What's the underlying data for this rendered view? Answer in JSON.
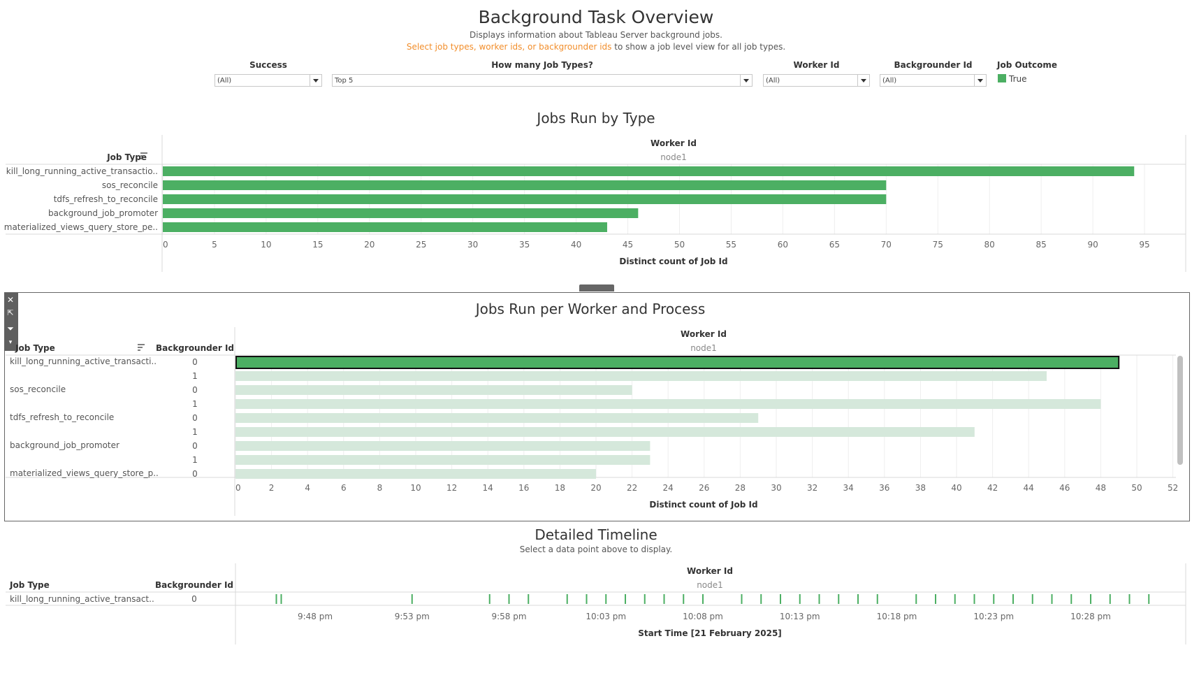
{
  "header": {
    "title": "Background Task Overview",
    "subtitle": "Displays information about Tableau Server background jobs.",
    "hint_highlight": "Select job types, worker ids, or backgrounder ids",
    "hint_rest": " to show a job level view for all job types."
  },
  "filters": {
    "success": {
      "label": "Success",
      "value": "(All)"
    },
    "job_types": {
      "label": "How many Job Types?",
      "value": "Top 5"
    },
    "worker_id": {
      "label": "Worker Id",
      "value": "(All)"
    },
    "backgrounder_id": {
      "label": "Backgrounder Id",
      "value": "(All)"
    },
    "legend": {
      "label": "Job Outcome",
      "item": "True",
      "color": "#4caf63"
    }
  },
  "colors": {
    "bar": "#4caf63",
    "bar_dim": "#d5e8db",
    "grid": "#eeeeee",
    "axis": "#d8d8d8"
  },
  "chart_data": [
    {
      "type": "bar",
      "title": "Jobs Run by Type",
      "row_header": "Job Type",
      "column_header": "Worker Id",
      "column_value": "node1",
      "xlabel": "Distinct count of Job Id",
      "categories": [
        "kill_long_running_active_transactio..",
        "sos_reconcile",
        "tdfs_refresh_to_reconcile",
        "background_job_promoter",
        "materialized_views_query_store_pe.."
      ],
      "values": [
        94,
        70,
        70,
        46,
        43
      ],
      "xlim": [
        0,
        97
      ],
      "ticks": [
        0,
        5,
        10,
        15,
        20,
        25,
        30,
        35,
        40,
        45,
        50,
        55,
        60,
        65,
        70,
        75,
        80,
        85,
        90,
        95
      ]
    },
    {
      "type": "bar",
      "title": "Jobs Run per Worker and Process",
      "row_header": "Job Type",
      "row_header2": "Backgrounder Id",
      "column_header": "Worker Id",
      "column_value": "node1",
      "xlabel": "Distinct count of Job Id",
      "rows": [
        {
          "job": "kill_long_running_active_transacti..",
          "bg": "0",
          "value": 49,
          "selected": true
        },
        {
          "job": "",
          "bg": "1",
          "value": 45
        },
        {
          "job": "sos_reconcile",
          "bg": "0",
          "value": 22
        },
        {
          "job": "",
          "bg": "1",
          "value": 48
        },
        {
          "job": "tdfs_refresh_to_reconcile",
          "bg": "0",
          "value": 29
        },
        {
          "job": "",
          "bg": "1",
          "value": 41
        },
        {
          "job": "background_job_promoter",
          "bg": "0",
          "value": 23
        },
        {
          "job": "",
          "bg": "1",
          "value": 23
        },
        {
          "job": "materialized_views_query_store_p..",
          "bg": "0",
          "value": 20
        }
      ],
      "xlim": [
        0,
        52.4
      ],
      "ticks": [
        0,
        2,
        4,
        6,
        8,
        10,
        12,
        14,
        16,
        18,
        20,
        22,
        24,
        26,
        28,
        30,
        32,
        34,
        36,
        38,
        40,
        42,
        44,
        46,
        48,
        50,
        52
      ]
    },
    {
      "type": "scatter",
      "title": "Detailed Timeline",
      "subtitle": "Select a data point above to display.",
      "row_header": "Job Type",
      "row_header2": "Backgrounder Id",
      "column_header": "Worker Id",
      "column_value": "node1",
      "row_job": "kill_long_running_active_transact..",
      "row_bg": "0",
      "xlabel": "Start Time [21 February 2025]",
      "tick_labels": [
        "9:48 pm",
        "9:53 pm",
        "9:58 pm",
        "10:03 pm",
        "10:08 pm",
        "10:13 pm",
        "10:18 pm",
        "10:23 pm",
        "10:28 pm"
      ],
      "events": [
        "9:46 pm",
        "9:46 pm",
        "9:53 pm",
        "9:57 pm",
        "9:58 pm",
        "9:59 pm",
        "10:01 pm",
        "10:02 pm",
        "10:03 pm",
        "10:04 pm",
        "10:05 pm",
        "10:06 pm",
        "10:07 pm",
        "10:08 pm",
        "10:10 pm",
        "10:11 pm",
        "10:12 pm",
        "10:13 pm",
        "10:14 pm",
        "10:15 pm",
        "10:16 pm",
        "10:17 pm",
        "10:19 pm",
        "10:20 pm",
        "10:21 pm",
        "10:22 pm",
        "10:23 pm",
        "10:24 pm",
        "10:25 pm",
        "10:26 pm",
        "10:27 pm",
        "10:28 pm",
        "10:29 pm",
        "10:30 pm",
        "10:31 pm"
      ]
    }
  ]
}
